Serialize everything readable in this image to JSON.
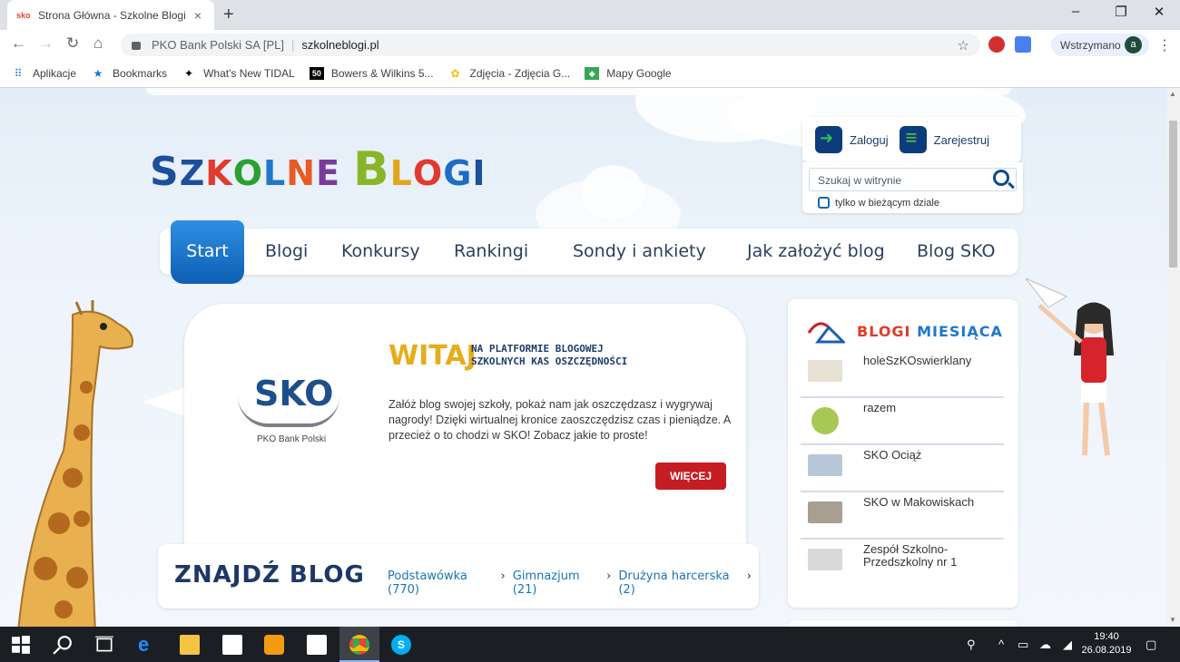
{
  "browser": {
    "tab_title": "Strona Główna - Szkolne Blogi",
    "tab_favicon": "sko",
    "new_tab_label": "+",
    "close_tab_label": "×",
    "window_controls": {
      "minimize": "–",
      "maximize": "❐",
      "close": "✕"
    },
    "address": {
      "issuer": "PKO Bank Polski SA [PL]",
      "url": "szkolneblogi.pl"
    },
    "profile": {
      "status": "Wstrzymano",
      "avatar_letter": "a"
    },
    "bookmarks": [
      {
        "label": "Aplikacje",
        "icon": "apps-grid-icon"
      },
      {
        "label": "Bookmarks",
        "icon": "star-icon"
      },
      {
        "label": "What's New TIDAL",
        "icon": "tidal-icon"
      },
      {
        "label": "Bowers & Wilkins 5...",
        "icon": "bw-50-icon"
      },
      {
        "label": "Zdjęcia - Zdjęcia G...",
        "icon": "google-photos-icon"
      },
      {
        "label": "Mapy Google",
        "icon": "google-maps-icon"
      }
    ]
  },
  "site": {
    "logo_letters": [
      {
        "ch": "S",
        "color": "#1d4f9c"
      },
      {
        "ch": "Z",
        "color": "#1d4f9c"
      },
      {
        "ch": "K",
        "color": "#e23a2b"
      },
      {
        "ch": "O",
        "color": "#2aa02f"
      },
      {
        "ch": "L",
        "color": "#1f78c8"
      },
      {
        "ch": "N",
        "color": "#e85b25"
      },
      {
        "ch": "E",
        "color": "#7a3b9d"
      },
      {
        "ch": " ",
        "color": "#000"
      },
      {
        "ch": "B",
        "color": "#8ab528"
      },
      {
        "ch": "L",
        "color": "#e2a61c"
      },
      {
        "ch": "O",
        "color": "#e23a2b"
      },
      {
        "ch": "G",
        "color": "#1f6cc1"
      },
      {
        "ch": "I",
        "color": "#1d4f9c"
      }
    ],
    "login": {
      "login_label": "Zaloguj",
      "register_label": "Zarejestruj"
    },
    "search": {
      "placeholder": "Szukaj w witrynie",
      "checkbox_label": "tylko w bieżącym dziale"
    },
    "menu": [
      "Start",
      "Blogi",
      "Konkursy",
      "Rankingi",
      "Sondy i ankiety",
      "Jak założyć blog",
      "Blog SKO"
    ],
    "welcome": {
      "sko_logo": "SKO",
      "bank_name": "PKO Bank Polski",
      "heading": "WITAJ",
      "tagline_line1": "NA PLATFORMIE BLOGOWEJ",
      "tagline_line2": "SZKOLNYCH KAS OSZCZĘDNOŚCI",
      "text": "Załóż blog swojej szkoły, pokaż nam jak oszczędzasz i wygrywaj nagrody! Dzięki wirtualnej kronice zaoszczędzisz czas i pieniądze. A przecież o to chodzi w SKO! Zobacz jakie to proste!",
      "button": "WIĘCEJ"
    },
    "find_blog": {
      "title": "ZNAJDŹ BLOG",
      "links": [
        {
          "label": "Podstawówka (770)"
        },
        {
          "label": "Gimnazjum (21)"
        },
        {
          "label": "Drużyna harcerska (2)"
        }
      ],
      "chevron": "›"
    },
    "blogs_of_month": {
      "title": "BLOGI MIESIĄCA",
      "title_colors": [
        "#e23a2b",
        "#2aa02f",
        "#1f78c8",
        "#e2a61c",
        "#7a3b9d"
      ],
      "items": [
        {
          "name": "holeSzKOswierklany"
        },
        {
          "name": "razem"
        },
        {
          "name": "SKO Ociąż"
        },
        {
          "name": "SKO w Makowiskach"
        },
        {
          "name": "Zespół Szkolno-Przedszkolny nr 1"
        }
      ]
    }
  },
  "taskbar": {
    "time": "19:40",
    "date": "26.08.2019"
  },
  "colors": {
    "primary_blue": "#0d5fb4",
    "accent_red": "#c61d23",
    "heading_yellow": "#e6ad1b"
  }
}
